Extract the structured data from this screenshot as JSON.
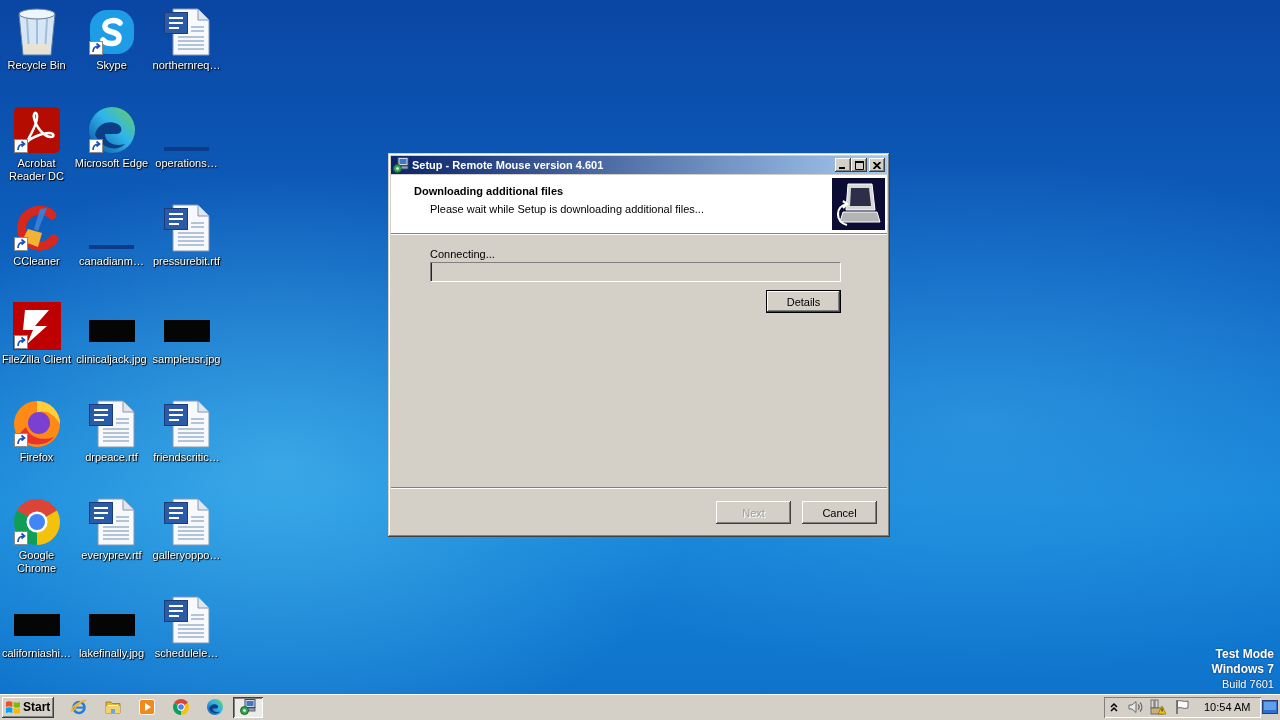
{
  "desktop": {
    "icons": [
      {
        "label": "Recycle Bin",
        "kind": "recycle-bin",
        "shortcut": false
      },
      {
        "label": "Skype",
        "kind": "skype",
        "shortcut": true
      },
      {
        "label": "northernreq…",
        "kind": "word-document",
        "shortcut": false
      },
      {
        "label": "Acrobat Reader DC",
        "kind": "acrobat",
        "shortcut": true
      },
      {
        "label": "Microsoft Edge",
        "kind": "edge",
        "shortcut": true
      },
      {
        "label": "operations…",
        "kind": "thin-image",
        "shortcut": false
      },
      {
        "label": "CCleaner",
        "kind": "ccleaner",
        "shortcut": true
      },
      {
        "label": "canadianm…",
        "kind": "thin-image",
        "shortcut": false
      },
      {
        "label": "pressurebit.rtf",
        "kind": "word-document",
        "shortcut": false
      },
      {
        "label": "FileZilla Client",
        "kind": "filezilla",
        "shortcut": true
      },
      {
        "label": "clinicaljack.jpg",
        "kind": "dark-image",
        "shortcut": false
      },
      {
        "label": "sampleusr.jpg",
        "kind": "dark-image",
        "shortcut": false
      },
      {
        "label": "Firefox",
        "kind": "firefox",
        "shortcut": true
      },
      {
        "label": "drpeace.rtf",
        "kind": "word-document",
        "shortcut": false
      },
      {
        "label": "friendscritic…",
        "kind": "word-document",
        "shortcut": false
      },
      {
        "label": "Google Chrome",
        "kind": "chrome",
        "shortcut": true
      },
      {
        "label": "everyprev.rtf",
        "kind": "word-document",
        "shortcut": false
      },
      {
        "label": "galleryoppo…",
        "kind": "word-document",
        "shortcut": false
      },
      {
        "label": "californiashi…",
        "kind": "dark-image",
        "shortcut": false
      },
      {
        "label": "lakefinally.jpg",
        "kind": "dark-image",
        "shortcut": false
      },
      {
        "label": "schedulele…",
        "kind": "word-document",
        "shortcut": false
      }
    ],
    "test_mode": {
      "label": "Test Mode",
      "edition": "Windows 7",
      "build": "Build 7601"
    }
  },
  "window": {
    "title": "Setup - Remote Mouse version 4.601",
    "heading": "Downloading additional files",
    "subheading": "Please wait while Setup is downloading additional files...",
    "status": "Connecting...",
    "progress": {
      "level": 0
    },
    "details_button": "Details",
    "buttons": [
      {
        "label": "Next",
        "disabled": true
      },
      {
        "label": "Cancel",
        "disabled": false
      }
    ]
  },
  "taskbar": {
    "start": "Start",
    "tasks": [
      {
        "selected": true
      }
    ],
    "clock": "10:54 AM"
  }
}
